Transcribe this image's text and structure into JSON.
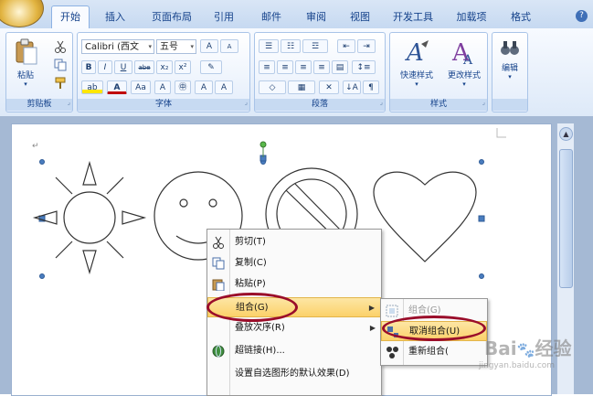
{
  "tabs": [
    "开始",
    "插入",
    "页面布局",
    "引用",
    "邮件",
    "审阅",
    "视图",
    "开发工具",
    "加载项",
    "格式"
  ],
  "active_tab": "开始",
  "ribbon": {
    "clipboard": {
      "label": "剪贴板",
      "paste": "粘贴",
      "cut_icon": "scissors-icon",
      "copy_icon": "copy-icon",
      "format_painter_icon": "brush-icon"
    },
    "font": {
      "label": "字体",
      "font_name": "Calibri (西文",
      "font_size": "五号",
      "bold": "B",
      "italic": "I",
      "underline": "U",
      "strike": "abe",
      "subscript": "x₂",
      "superscript": "x²",
      "grow": "A",
      "shrink": "A",
      "change_case": "Aa"
    },
    "paragraph": {
      "label": "段落"
    },
    "styles": {
      "label": "样式",
      "quick_styles": "快速样式",
      "change_styles": "更改样式"
    },
    "editing": {
      "label": "",
      "edit": "编辑"
    }
  },
  "context_menu": {
    "items": [
      {
        "label": "剪切(T)",
        "icon": "scissors-icon"
      },
      {
        "label": "复制(C)",
        "icon": "copy-icon"
      },
      {
        "label": "粘贴(P)",
        "icon": "paste-icon"
      },
      {
        "label": "组合(G)",
        "icon": "",
        "submenu": true,
        "highlighted": true
      },
      {
        "label": "叠放次序(R)",
        "icon": "",
        "submenu": true
      },
      {
        "label": "超链接(H)...",
        "icon": "globe-link-icon"
      },
      {
        "label": "设置自选图形的默认效果(D)",
        "icon": ""
      }
    ]
  },
  "submenu": {
    "items": [
      {
        "label": "组合(G)",
        "icon": "group-icon",
        "disabled": true
      },
      {
        "label": "取消组合(U)",
        "icon": "ungroup-icon",
        "highlighted": true
      },
      {
        "label": "重新组合(",
        "icon": "regroup-icon"
      }
    ]
  },
  "watermark": {
    "brand": "Bai",
    "brand2": "经验",
    "url": "jingyan.baidu.com"
  },
  "colors": {
    "ribbon_text": "#15428b",
    "highlight": "#fbd16a",
    "annotation": "#9a0d2a"
  }
}
